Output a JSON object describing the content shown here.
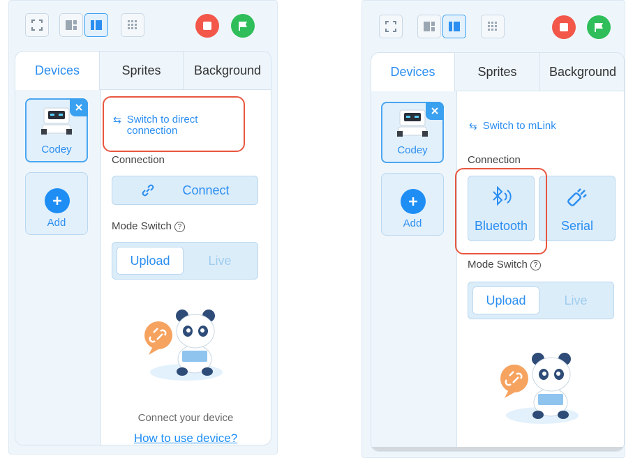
{
  "left": {
    "tabs": [
      "Devices",
      "Sprites",
      "Background"
    ],
    "device": {
      "name": "Codey"
    },
    "add_label": "Add",
    "switch_link": [
      "Switch to direct",
      "connection"
    ],
    "connection_label": "Connection",
    "connect_button": "Connect",
    "mode_switch_label": "Mode Switch",
    "mode_upload": "Upload",
    "mode_live": "Live",
    "empty_text": "Connect your device",
    "howto_link": "How to use device?"
  },
  "right": {
    "tabs": [
      "Devices",
      "Sprites",
      "Background"
    ],
    "device": {
      "name": "Codey"
    },
    "add_label": "Add",
    "switch_link": "Switch to mLink",
    "connection_label": "Connection",
    "bluetooth_label": "Bluetooth",
    "serial_label": "Serial",
    "mode_switch_label": "Mode Switch",
    "mode_upload": "Upload",
    "mode_live": "Live"
  },
  "colors": {
    "accent": "#2b8ef0",
    "highlight": "#e8563f",
    "stop": "#f2574a",
    "go": "#2fbe5a"
  },
  "icons": [
    "fullscreen-icon",
    "layout-small-stage-icon",
    "layout-large-stage-icon",
    "grid-icon",
    "stop-icon",
    "green-flag-icon",
    "close-icon",
    "plus-icon",
    "swap-arrows-icon",
    "link-icon",
    "question-icon",
    "bluetooth-icon",
    "serial-cable-icon"
  ]
}
